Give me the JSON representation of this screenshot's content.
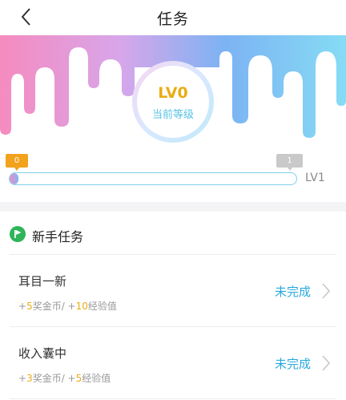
{
  "nav": {
    "title": "任务"
  },
  "level": {
    "value": "LV0",
    "label": "当前等级",
    "progress_start": "0",
    "progress_end": "1",
    "next_level": "LV1",
    "progress_fraction": 0.03
  },
  "section": {
    "title": "新手任务"
  },
  "tasks": [
    {
      "name": "耳目一新",
      "reward_plus1": "+",
      "coins": "5",
      "coins_label": "奖金币/ +",
      "exp": "10",
      "exp_label": "经验值",
      "status": "未完成"
    },
    {
      "name": "收入囊中",
      "reward_plus1": "+",
      "coins": "3",
      "coins_label": "奖金币/ +",
      "exp": "5",
      "exp_label": "经验值",
      "status": "未完成"
    }
  ],
  "colors": {
    "accent_gold": "#e9ad14",
    "accent_blue": "#2aa9dd",
    "banner_pink": "#f58bbf",
    "banner_blue": "#86d7f5"
  }
}
